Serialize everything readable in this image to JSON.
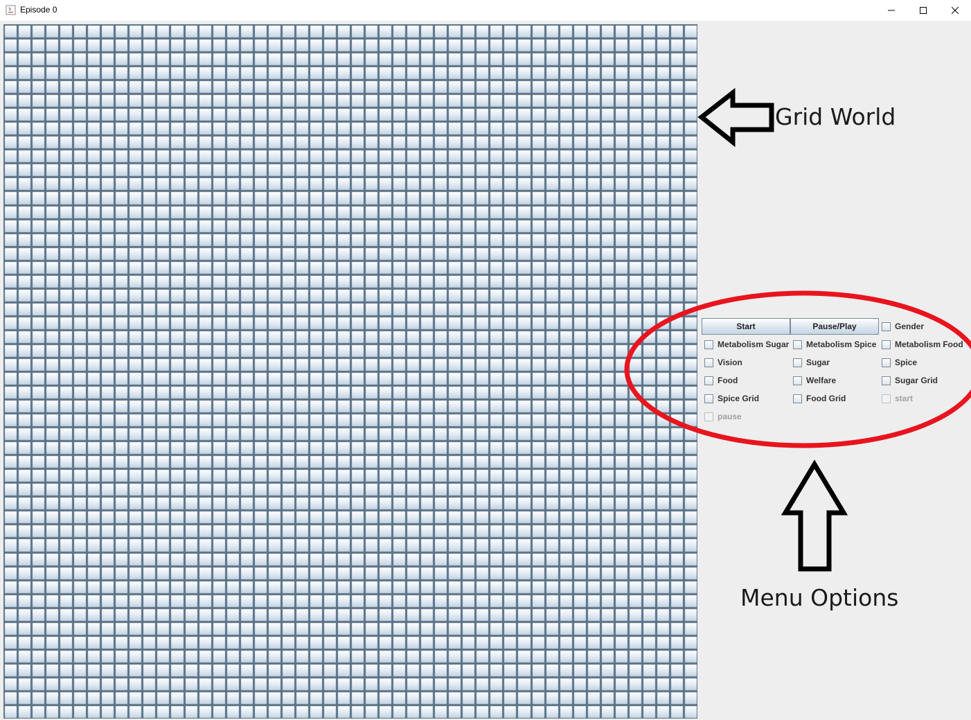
{
  "window": {
    "title": "Episode 0",
    "controls": [
      "minimize-icon",
      "maximize-icon",
      "close-icon"
    ]
  },
  "grid": {
    "columns": 50,
    "rows": 50,
    "cell_fill": "#e3ecf4",
    "line_color": "#5a7186"
  },
  "menu": {
    "buttons": {
      "start": "Start",
      "pause_play": "Pause/Play"
    },
    "checkboxes": [
      {
        "label": "Gender",
        "checked": false,
        "enabled": true
      },
      {
        "label": "Metabolism Sugar",
        "checked": false,
        "enabled": true
      },
      {
        "label": "Metabolism Spice",
        "checked": false,
        "enabled": true
      },
      {
        "label": "Metabolism Food",
        "checked": false,
        "enabled": true
      },
      {
        "label": "Vision",
        "checked": false,
        "enabled": true
      },
      {
        "label": "Sugar",
        "checked": false,
        "enabled": true
      },
      {
        "label": "Spice",
        "checked": false,
        "enabled": true
      },
      {
        "label": "Food",
        "checked": false,
        "enabled": true
      },
      {
        "label": "Welfare",
        "checked": false,
        "enabled": true
      },
      {
        "label": "Sugar Grid",
        "checked": false,
        "enabled": true
      },
      {
        "label": "Spice Grid",
        "checked": false,
        "enabled": true
      },
      {
        "label": "Food Grid",
        "checked": false,
        "enabled": true
      },
      {
        "label": "start",
        "checked": false,
        "enabled": false
      },
      {
        "label": "pause",
        "checked": false,
        "enabled": false
      }
    ]
  },
  "annotations": {
    "grid_world": "Grid World",
    "menu_options": "Menu Options",
    "ellipse_color": "#e8141e",
    "arrow_color": "#000000"
  }
}
